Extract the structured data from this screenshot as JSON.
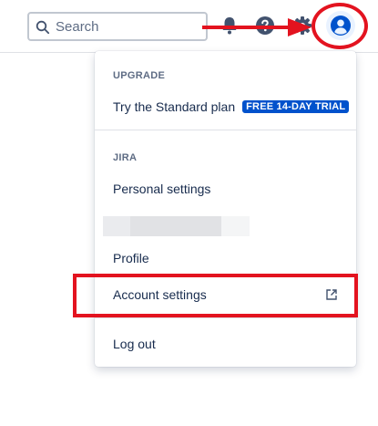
{
  "search": {
    "placeholder": "Search"
  },
  "menu": {
    "upgrade": {
      "title": "UPGRADE",
      "plan_label": "Try the Standard plan",
      "trial_badge": "FREE 14-DAY TRIAL"
    },
    "jira": {
      "title": "JIRA",
      "personal_settings": "Personal settings"
    },
    "profile": "Profile",
    "account_settings": "Account settings",
    "logout": "Log out"
  },
  "icons": {
    "search": "search-icon",
    "notifications": "bell-icon",
    "help": "help-icon",
    "settings": "gear-icon",
    "avatar": "user-avatar-icon",
    "external": "external-link-icon"
  },
  "colors": {
    "accent": "#0052cc",
    "annotation": "#e3131f"
  }
}
